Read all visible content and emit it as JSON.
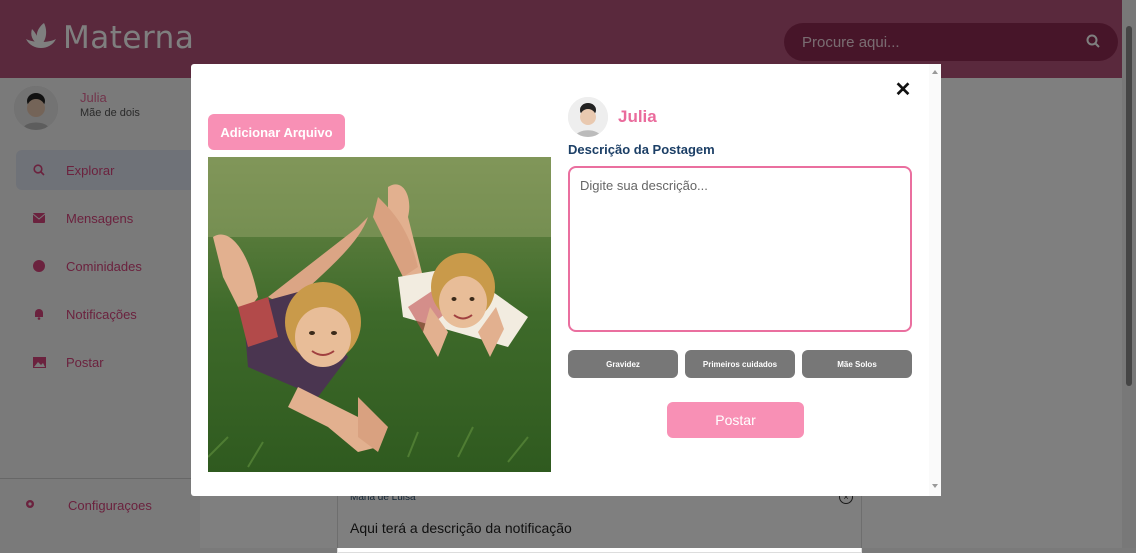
{
  "app": {
    "name": "Materna"
  },
  "search": {
    "placeholder": "Procure aqui..."
  },
  "user": {
    "name": "Julia",
    "role": "Mãe de dois"
  },
  "sidebar": {
    "items": [
      {
        "label": "Explorar",
        "icon": "search-icon",
        "active": true
      },
      {
        "label": "Mensagens",
        "icon": "mail-icon"
      },
      {
        "label": "Cominidades",
        "icon": "community-icon"
      },
      {
        "label": "Notificações",
        "icon": "bell-icon"
      },
      {
        "label": "Postar",
        "icon": "image-icon"
      }
    ],
    "settings_label": "Configuraçoes"
  },
  "notification": {
    "author": "Maria de Luisa",
    "text": "Aqui terá a descrição da notificação"
  },
  "modal": {
    "close_label": "✕",
    "add_file_label": "Adicionar Arquivo",
    "author_name": "Julia",
    "description_label": "Descrição da Postagem",
    "description_placeholder": "Digite sua descrição...",
    "tags": [
      "Gravidez",
      "Primeiros cuidados",
      "Mãe Solos"
    ],
    "post_label": "Postar"
  },
  "colors": {
    "brand": "#b5527a",
    "accent_pink": "#f890b5",
    "label_navy": "#1c3f66",
    "tag_gray": "#777777"
  }
}
